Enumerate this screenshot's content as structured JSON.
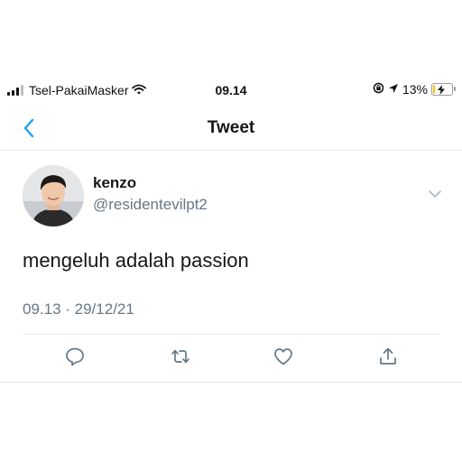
{
  "status_bar": {
    "carrier": "Tsel-PakaiMasker",
    "time": "09.14",
    "battery_percent": "13%",
    "battery_level": 0.13,
    "icons": [
      "signal-icon",
      "wifi-icon",
      "orientation-lock-icon",
      "location-icon",
      "battery-icon"
    ]
  },
  "nav": {
    "title": "Tweet",
    "back_icon": "chevron-left-icon"
  },
  "tweet": {
    "display_name": "kenzo",
    "handle": "@residentevilpt2",
    "text": "mengeluh adalah passion",
    "timestamp": "09.13 · 29/12/21",
    "actions": [
      "reply-icon",
      "retweet-icon",
      "like-icon",
      "share-icon"
    ]
  },
  "colors": {
    "accent": "#1da1f2",
    "secondary_text": "#657786",
    "divider": "#e1e8ed",
    "battery": "#f3c100"
  }
}
